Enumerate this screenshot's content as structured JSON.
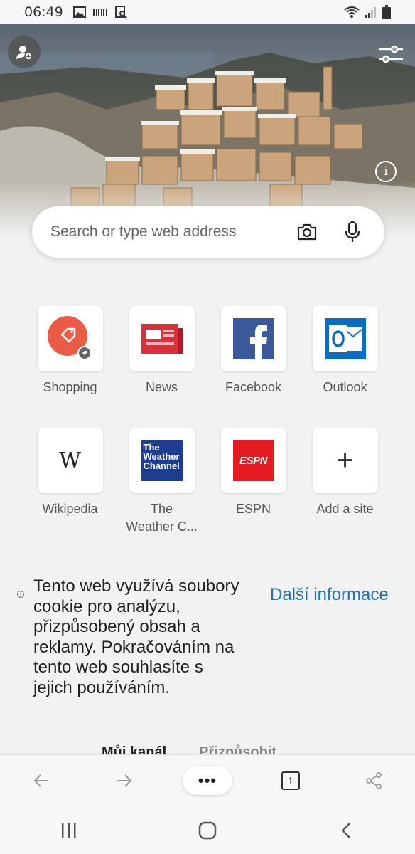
{
  "status_bar": {
    "time": "06:49",
    "icons": [
      "image-icon",
      "barcode-icon",
      "screenshot-icon"
    ],
    "right_icons": [
      "wifi-icon",
      "signal-icon",
      "battery-icon"
    ]
  },
  "hero": {
    "profile_icon": "add-profile-icon",
    "settings_icon": "page-settings-icon",
    "info_label": "i"
  },
  "search": {
    "placeholder": "Search or type web address",
    "camera_icon": "camera-icon",
    "mic_icon": "microphone-icon"
  },
  "top_sites": [
    {
      "label": "Shopping",
      "icon": "shopping-tag-icon"
    },
    {
      "label": "News",
      "icon": "news-icon"
    },
    {
      "label": "Facebook",
      "icon": "facebook-icon"
    },
    {
      "label": "Outlook",
      "icon": "outlook-icon"
    },
    {
      "label": "Wikipedia",
      "icon": "wikipedia-icon",
      "glyph": "W"
    },
    {
      "label": "The Weather C...",
      "label_line1": "The",
      "label_line2": "Weather C...",
      "icon": "weather-channel-icon",
      "logo_text": [
        "The",
        "Weather",
        "Channel"
      ]
    },
    {
      "label": "ESPN",
      "icon": "espn-icon",
      "logo_text": "ESPN"
    },
    {
      "label": "Add a site",
      "icon": "plus-icon",
      "glyph": "+"
    }
  ],
  "cookie_notice": {
    "text": "Tento web využívá soubory cookie pro analýzu, přizpůsobený obsah a reklamy. Pokračováním na tento web souhlasíte s jejich používáním.",
    "link": "Další informace"
  },
  "feed": {
    "tab_my_feed": "Můj kanál",
    "tab_customize": "Přizpůsobit"
  },
  "toolbar": {
    "back_icon": "back-arrow-icon",
    "forward_icon": "forward-arrow-icon",
    "more_label": "•••",
    "tab_count": "1",
    "share_icon": "share-icon"
  },
  "nav_bar": {
    "recents_icon": "recent-apps-icon",
    "home_icon": "home-icon",
    "back_icon": "system-back-icon"
  },
  "colors": {
    "accent_link": "#1f6fb5",
    "shopping": "#ea5b47",
    "news": "#d9303c",
    "facebook": "#3b5998",
    "outlook": "#0f6cbd",
    "weather": "#1d3d8f",
    "espn": "#e51b24"
  }
}
